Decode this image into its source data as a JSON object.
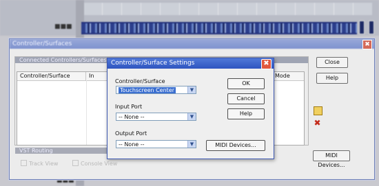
{
  "background_app": {
    "dots_top": "■■■",
    "dots_bottom": "■■■"
  },
  "outer_dialog": {
    "title": "Controller/Surfaces",
    "close_glyph": "✖",
    "group_title": "Connected Controllers/Surfaces",
    "columns": [
      "Controller/Surface",
      "In",
      "Mode"
    ],
    "buttons": {
      "close": "Close",
      "help": "Help",
      "midi_devices": "MIDI Devices..."
    },
    "vst_group_title": "VST Routing",
    "vst_options": [
      "Track View",
      "Console View"
    ]
  },
  "settings_dialog": {
    "title": "Controller/Surface Settings",
    "close_glyph": "✖",
    "controller_label": "Controller/Surface",
    "controller_value": "Touchscreen Center",
    "input_label": "Input Port",
    "input_value": "-- None --",
    "output_label": "Output Port",
    "output_value": "-- None --",
    "dropdown_glyph": "▼",
    "buttons": {
      "ok": "OK",
      "cancel": "Cancel",
      "help": "Help",
      "midi_devices": "MIDI Devices..."
    }
  },
  "colors": {
    "title_active": "#2f55c0",
    "title_inactive": "#7f93cf",
    "selection": "#3b6fd0"
  }
}
